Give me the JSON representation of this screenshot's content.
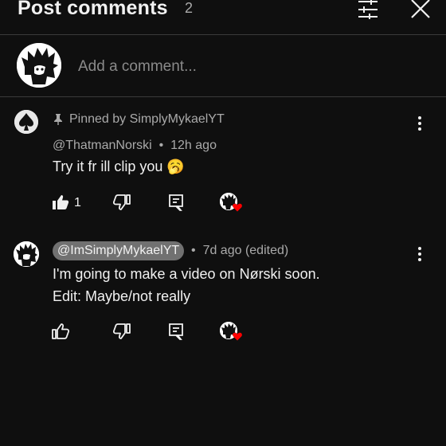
{
  "header": {
    "title": "Post comments",
    "count": "2"
  },
  "add_comment": {
    "placeholder": "Add a comment..."
  },
  "comments": [
    {
      "pinned_label": "Pinned by SimplyMykaelYT",
      "author": "@ThatmanNorski",
      "time": "12h ago",
      "text_lines": [
        "Try it fr ill clip you 🥱"
      ],
      "likes": "1",
      "liked": true,
      "creator_heart": true
    },
    {
      "author": "@ImSimplyMykaelYT",
      "author_is_creator": true,
      "time": "7d ago (edited)",
      "text_lines": [
        "I'm going to make a video on Nørski soon.",
        "Edit: Maybe/not really"
      ],
      "likes": "",
      "liked": false,
      "creator_heart": true
    }
  ],
  "colors": {
    "background": "#0f0f0f",
    "text_primary": "#f1f1f1",
    "text_secondary": "#aaaaaa",
    "creator_chip": "#717171",
    "heart": "#ff0000"
  },
  "icons": {
    "filter": "sliders-icon",
    "close": "close-icon",
    "pin": "pin-icon",
    "more": "more-vert-icon",
    "like": "thumb-up-icon",
    "dislike": "thumb-down-icon",
    "reply": "reply-icon"
  }
}
